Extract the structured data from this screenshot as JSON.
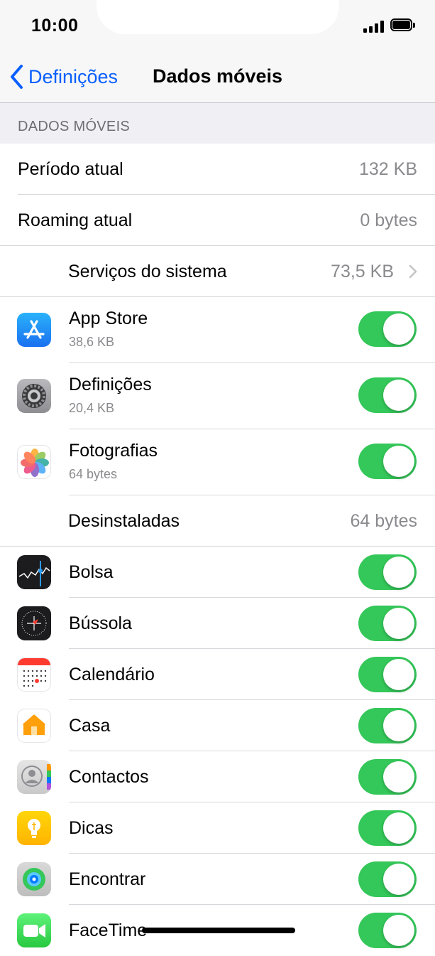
{
  "status": {
    "time": "10:00"
  },
  "nav": {
    "back_label": "Definições",
    "title": "Dados móveis"
  },
  "section": {
    "header": "DADOS MÓVEIS"
  },
  "summary": [
    {
      "label": "Período atual",
      "value": "132 KB"
    },
    {
      "label": "Roaming atual",
      "value": "0 bytes"
    }
  ],
  "system_services": {
    "label": "Serviços do sistema",
    "value": "73,5 KB"
  },
  "apps_top": [
    {
      "name": "App Store",
      "usage": "38,6 KB",
      "icon": "app-store-icon",
      "enabled": true
    },
    {
      "name": "Definições",
      "usage": "20,4 KB",
      "icon": "settings-icon",
      "enabled": true
    },
    {
      "name": "Fotografias",
      "usage": "64 bytes",
      "icon": "photos-icon",
      "enabled": true
    }
  ],
  "uninstalled": {
    "label": "Desinstaladas",
    "value": "64 bytes"
  },
  "apps": [
    {
      "name": "Bolsa",
      "icon": "stocks-icon",
      "enabled": true
    },
    {
      "name": "Bússola",
      "icon": "compass-icon",
      "enabled": true
    },
    {
      "name": "Calendário",
      "icon": "calendar-icon",
      "enabled": true
    },
    {
      "name": "Casa",
      "icon": "home-icon",
      "enabled": true
    },
    {
      "name": "Contactos",
      "icon": "contacts-icon",
      "enabled": true
    },
    {
      "name": "Dicas",
      "icon": "tips-icon",
      "enabled": true
    },
    {
      "name": "Encontrar",
      "icon": "find-my-icon",
      "enabled": true
    },
    {
      "name": "FaceTime",
      "icon": "facetime-icon",
      "enabled": true
    }
  ],
  "colors": {
    "accent": "#0a60ff",
    "toggle_on": "#34c759",
    "group_bg": "#efeff4"
  }
}
